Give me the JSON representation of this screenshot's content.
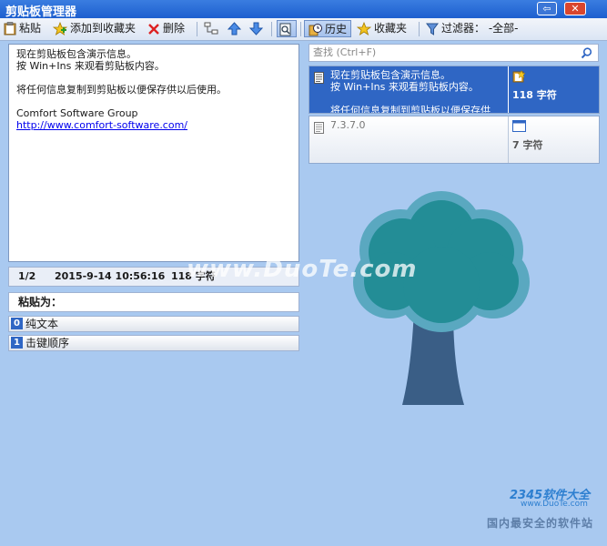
{
  "window": {
    "title": "剪贴板管理器",
    "restore_glyph": "⇦",
    "close_glyph": "✕"
  },
  "toolbar": {
    "paste": "粘贴",
    "add_favorite": "添加到收藏夹",
    "delete": "删除",
    "history": "历史",
    "favorites": "收藏夹",
    "filter": "过滤器： -全部-"
  },
  "preview": {
    "lines": [
      "现在剪贴板包含演示信息。",
      "按 Win+Ins 来观看剪贴板内容。",
      "",
      "将任何信息复制到剪贴板以便保存供以后使用。",
      "",
      "Comfort Software Group"
    ],
    "link": "http://www.comfort-software.com/"
  },
  "status": {
    "position": "1/2",
    "datetime": "2015-9-14 10:56:16",
    "size": "118 字符"
  },
  "paste_as": {
    "label": "粘贴为：",
    "options": [
      {
        "key": "0",
        "label": "纯文本"
      },
      {
        "key": "1",
        "label": "击键顺序"
      }
    ]
  },
  "search": {
    "placeholder": "查找 (Ctrl+F)"
  },
  "clips": [
    {
      "lines": [
        "现在剪贴板包含演示信息。",
        "按 Win+Ins 来观看剪贴板内容。",
        "",
        "将任何信息复制到剪贴板以便保存供"
      ],
      "count": "118 字符"
    },
    {
      "lines": [
        "7.3.7.0"
      ],
      "count": "7 字符"
    }
  ],
  "watermarks": {
    "center": "www.DuoTe.com",
    "brand": "2345软件大全",
    "brand_url": "www.DuoTe.com",
    "slogan": "国内最安全的软件站"
  },
  "colors": {
    "background": "#a9c9f0",
    "selected": "#2f66c4",
    "tree_canopy": "#238d96",
    "tree_trunk": "#3a5e86"
  }
}
